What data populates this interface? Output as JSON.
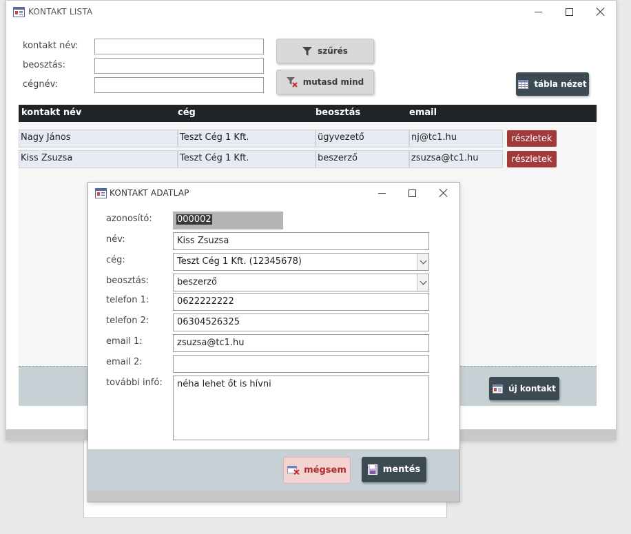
{
  "main_window": {
    "title": "KONTAKT LISTA",
    "filters": [
      {
        "label": "kontakt név:",
        "value": ""
      },
      {
        "label": "beosztás:",
        "value": ""
      },
      {
        "label": "cégnév:",
        "value": ""
      }
    ],
    "filter_button": "szűrés",
    "show_all_button": "mutasd mind",
    "table_view_button": "tábla nézet",
    "new_contact_button": "új kontakt",
    "table": {
      "headers": [
        "kontakt név",
        "cég",
        "beosztás",
        "email"
      ],
      "rows": [
        {
          "name": "Nagy János",
          "company": "Teszt Cég 1 Kft.",
          "position": "ügyvezető",
          "email": "nj@tc1.hu",
          "action": "részletek"
        },
        {
          "name": "Kiss Zsuzsa",
          "company": "Teszt Cég 1 Kft.",
          "position": "beszerző",
          "email": "zsuzsa@tc1.hu",
          "action": "részletek"
        }
      ]
    }
  },
  "dialog": {
    "title": "KONTAKT ADATLAP",
    "fields": {
      "id_label": "azonosító:",
      "id_value": "000002",
      "name_label": "név:",
      "name_value": "Kiss Zsuzsa",
      "company_label": "cég:",
      "company_value": "Teszt Cég 1 Kft. (12345678)",
      "position_label": "beosztás:",
      "position_value": "beszerző",
      "phone1_label": "telefon 1:",
      "phone1_value": "0622222222",
      "phone2_label": "telefon 2:",
      "phone2_value": "06304526325",
      "email1_label": "email 1:",
      "email1_value": "zsuzsa@tc1.hu",
      "email2_label": "email 2:",
      "email2_value": "",
      "info_label": "további infó:",
      "info_value": "néha lehet őt is hívni"
    },
    "cancel_button": "mégsem",
    "save_button": "mentés"
  },
  "colors": {
    "dark_button": "#3c4a52",
    "detail_button": "#a13a3a",
    "cancel_bg": "#f4d3d3",
    "header_bg": "#202427"
  }
}
